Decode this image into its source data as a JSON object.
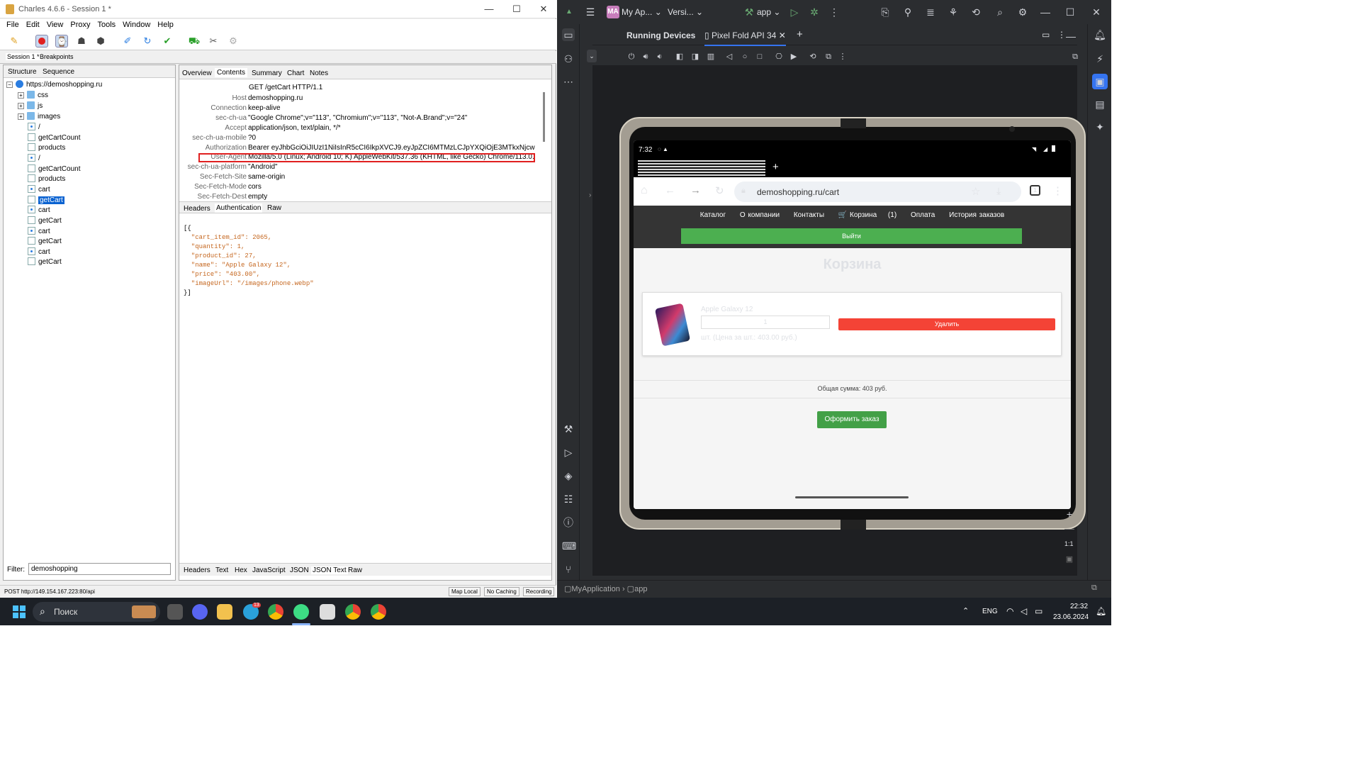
{
  "charles": {
    "title": "Charles 4.6.6 - Session 1 *",
    "menu": [
      "File",
      "Edit",
      "View",
      "Proxy",
      "Tools",
      "Window",
      "Help"
    ],
    "session_tabs": [
      "Session 1 *",
      "Breakpoints"
    ],
    "left_tabs": [
      "Structure",
      "Sequence"
    ],
    "tree": {
      "root": "https://demoshopping.ru",
      "folders": [
        "css",
        "js",
        "images"
      ],
      "items": [
        "/",
        "getCartCount",
        "products",
        "/",
        "getCartCount",
        "products",
        "cart",
        "getCart",
        "cart",
        "getCart",
        "cart",
        "getCart",
        "cart",
        "getCart"
      ],
      "selected_index": 7
    },
    "filter_label": "Filter:",
    "filter_value": "demoshopping",
    "right_tabs": [
      "Overview",
      "Contents",
      "Summary",
      "Chart",
      "Notes"
    ],
    "request_line": "GET /getCart HTTP/1.1",
    "headers": [
      {
        "k": "Host",
        "v": "demoshopping.ru"
      },
      {
        "k": "Connection",
        "v": "keep-alive"
      },
      {
        "k": "sec-ch-ua",
        "v": "\"Google Chrome\";v=\"113\", \"Chromium\";v=\"113\", \"Not-A.Brand\";v=\"24\""
      },
      {
        "k": "Accept",
        "v": "application/json, text/plain, */*"
      },
      {
        "k": "sec-ch-ua-mobile",
        "v": "?0"
      },
      {
        "k": "Authorization",
        "v": "Bearer eyJhbGciOiJIUzI1NiIsInR5cCI6IkpXVCJ9.eyJpZCI6MTMzLCJpYXQiOjE3MTkxNjcwNDUsI..."
      },
      {
        "k": "User-Agent",
        "v": "Mozilla/5.0 (Linux; Android 10; K) AppleWebKit/537.36 (KHTML, like Gecko) Chrome/113.0.0..."
      },
      {
        "k": "sec-ch-ua-platform",
        "v": "\"Android\""
      },
      {
        "k": "Sec-Fetch-Site",
        "v": "same-origin"
      },
      {
        "k": "Sec-Fetch-Mode",
        "v": "cors"
      },
      {
        "k": "Sec-Fetch-Dest",
        "v": "empty"
      }
    ],
    "header_subtabs": [
      "Headers",
      "Authentication",
      "Raw"
    ],
    "json_lines": [
      "[{",
      "  \"cart_item_id\": 2065,",
      "  \"quantity\": 1,",
      "  \"product_id\": 27,",
      "  \"name\": \"Apple Galaxy 12\",",
      "  \"price\": \"403.00\",",
      "  \"imageUrl\": \"/images/phone.webp\"",
      "}]"
    ],
    "body_subtabs": [
      "Headers",
      "Text",
      "Hex",
      "JavaScript",
      "JSON",
      "JSON Text",
      "Raw"
    ],
    "status_text": "POST http://149.154.167.223:80/api",
    "status_buttons": [
      "Map Local",
      "No Caching",
      "Recording"
    ]
  },
  "studio": {
    "project_badge": "MA",
    "project_name": "My Ap...",
    "vcs": "Versi...",
    "run_config": "app",
    "tabs": [
      "Running Devices",
      "Pixel Fold API 34"
    ],
    "breadcrumb": [
      "MyApplication",
      "app"
    ]
  },
  "phone": {
    "time": "7:32",
    "url": "demoshopping.ru/cart",
    "tab_count": "1",
    "nav": [
      "Каталог",
      "О компании",
      "Контакты",
      "🛒 Корзина",
      "(1)",
      "Оплата",
      "История заказов"
    ],
    "logout": "Выйти",
    "heading": "Корзина",
    "product_name": "Apple Galaxy 12",
    "quantity": "1",
    "delete_label": "Удалить",
    "unit_price_text": "шт. (Цена за шт.: 403.00 руб.)",
    "total_text": "Общая сумма: 403 руб.",
    "checkout_label": "Оформить заказ",
    "zoom_label": "1:1"
  },
  "taskbar": {
    "search": "Поиск",
    "lang": "ENG",
    "time": "22:32",
    "date": "23.06.2024",
    "badge": "13"
  },
  "colors": {
    "charles_selection": "#0b63d1",
    "highlight_box": "#e02020",
    "logout_green": "#4caf50",
    "delete_red": "#f44336",
    "checkout_green": "#43a047",
    "studio_bg": "#2b2d30"
  }
}
